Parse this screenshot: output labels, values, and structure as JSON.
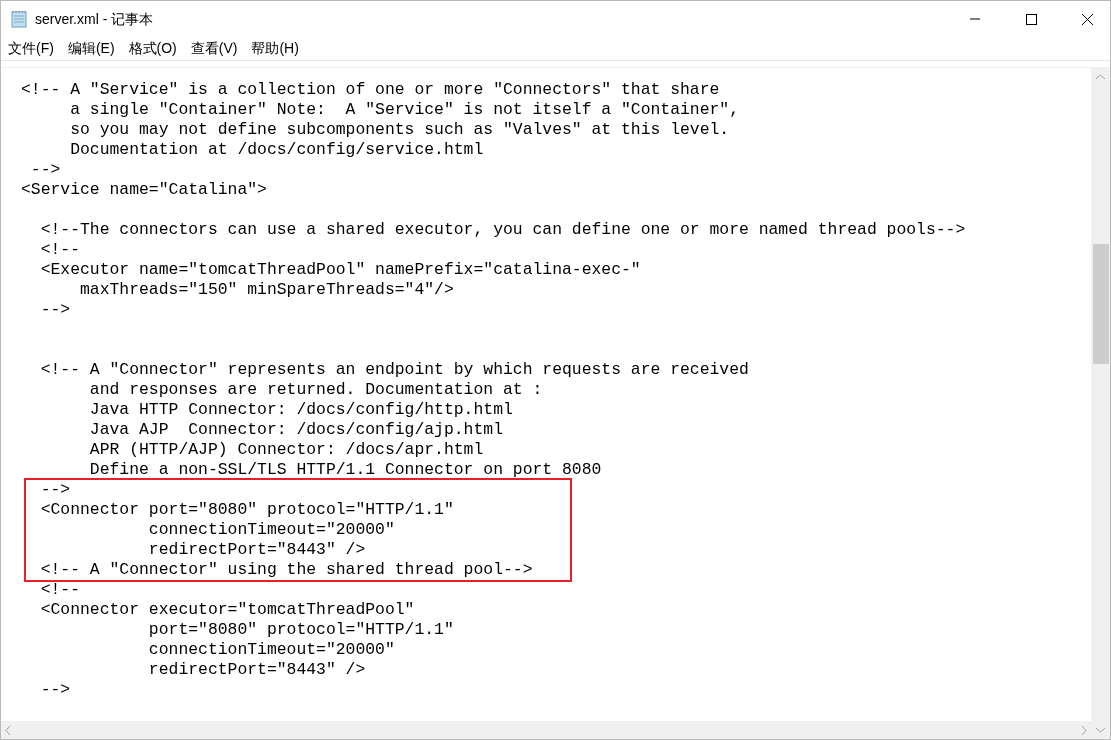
{
  "window": {
    "title": "server.xml - 记事本"
  },
  "menu": [
    {
      "label": "文件(F)"
    },
    {
      "label": "编辑(E)"
    },
    {
      "label": "格式(O)"
    },
    {
      "label": "查看(V)"
    },
    {
      "label": "帮助(H)"
    }
  ],
  "editor": {
    "blocks": [
      {
        "highlighted": false,
        "lines": [
          {
            "kind": "text",
            "text": "<!-- A \"Service\" is a collection of one or more \"Connectors\" that share"
          },
          {
            "kind": "text",
            "text": "     a single \"Container\" Note:  A \"Service\" is not itself a \"Container\","
          },
          {
            "kind": "text",
            "text": "     so you may not define subcomponents such as \"Valves\" at this level."
          },
          {
            "kind": "text",
            "text": "     Documentation at /docs/config/service.html"
          },
          {
            "kind": "text",
            "text": " -->"
          },
          {
            "kind": "text",
            "text": "<Service name=\"Catalina\">"
          },
          {
            "kind": "blank"
          },
          {
            "kind": "text",
            "text": "  <!--The connectors can use a shared executor, you can define one or more named thread pools-->"
          },
          {
            "kind": "text",
            "text": "  <!--"
          },
          {
            "kind": "text",
            "text": "  <Executor name=\"tomcatThreadPool\" namePrefix=\"catalina-exec-\""
          },
          {
            "kind": "text",
            "text": "      maxThreads=\"150\" minSpareThreads=\"4\"/>"
          },
          {
            "kind": "text",
            "text": "  -->"
          },
          {
            "kind": "blank"
          },
          {
            "kind": "blank"
          },
          {
            "kind": "text",
            "text": "  <!-- A \"Connector\" represents an endpoint by which requests are received"
          },
          {
            "kind": "text",
            "text": "       and responses are returned. Documentation at :"
          },
          {
            "kind": "text",
            "text": "       Java HTTP Connector: /docs/config/http.html"
          },
          {
            "kind": "text",
            "text": "       Java AJP  Connector: /docs/config/ajp.html"
          },
          {
            "kind": "text",
            "text": "       APR (HTTP/AJP) Connector: /docs/apr.html"
          },
          {
            "kind": "text",
            "text": "       Define a non-SSL/TLS HTTP/1.1 Connector on port 8080"
          }
        ]
      },
      {
        "highlighted": true,
        "lines": [
          {
            "kind": "text",
            "text": "  -->"
          },
          {
            "kind": "text",
            "text": "  <Connector port=\"8080\" protocol=\"HTTP/1.1\""
          },
          {
            "kind": "text",
            "text": "             connectionTimeout=\"20000\""
          },
          {
            "kind": "text",
            "text": "             redirectPort=\"8443\" />"
          },
          {
            "kind": "text",
            "text": "  <!-- A \"Connector\" using the shared thread pool-->"
          }
        ]
      },
      {
        "highlighted": false,
        "lines": [
          {
            "kind": "text",
            "text": "  <!--"
          },
          {
            "kind": "text",
            "text": "  <Connector executor=\"tomcatThreadPool\""
          },
          {
            "kind": "text",
            "text": "             port=\"8080\" protocol=\"HTTP/1.1\""
          },
          {
            "kind": "text",
            "text": "             connectionTimeout=\"20000\""
          },
          {
            "kind": "text",
            "text": "             redirectPort=\"8443\" />"
          },
          {
            "kind": "text",
            "text": "  -->"
          }
        ]
      }
    ]
  }
}
